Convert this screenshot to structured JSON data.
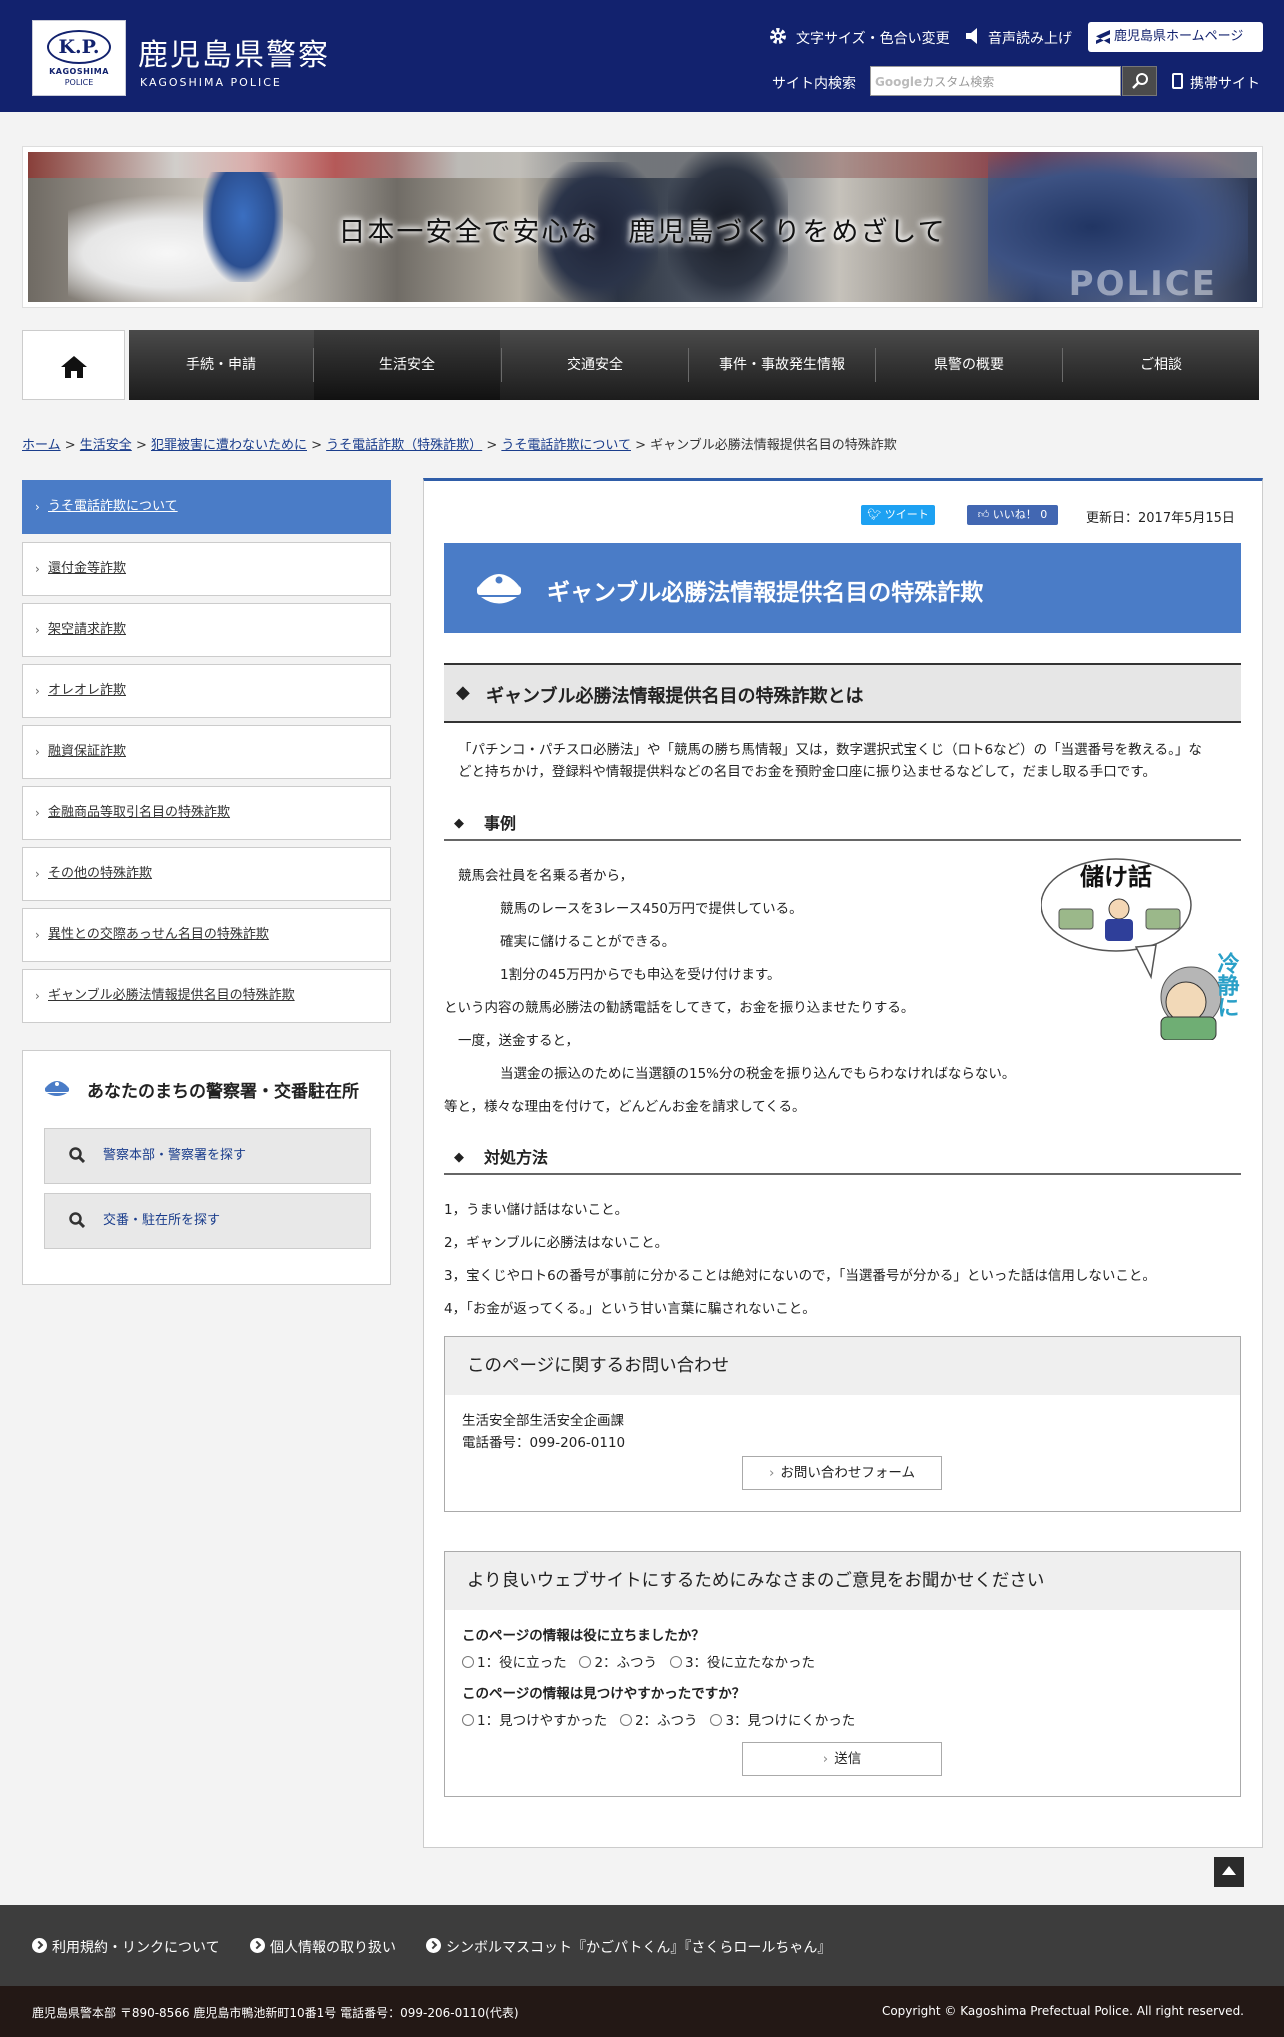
{
  "header": {
    "logo_mark": "K.P.",
    "logo_sub1": "KAGOSHIMA",
    "logo_sub2": "POLICE",
    "site_title": "鹿児島県警察",
    "site_subtitle": "KAGOSHIMA POLICE",
    "font_color_link": "文字サイズ・色合い変更",
    "voice_link": "音声読み上げ",
    "pref_link": "鹿児島県ホームページ",
    "search_label": "サイト内検索",
    "search_placeholder": "カスタム検索",
    "search_google": "Google",
    "mobile_link": "携帯サイト"
  },
  "banner": {
    "slogan": "日本一安全で安心な　鹿児島づくりをめざして",
    "police_text": "POLICE"
  },
  "nav": {
    "items": [
      {
        "label": "手続・申請"
      },
      {
        "label": "生活安全"
      },
      {
        "label": "交通安全"
      },
      {
        "label": "事件・事故発生情報"
      },
      {
        "label": "県警の概要"
      },
      {
        "label": "ご相談"
      }
    ]
  },
  "breadcrumb": {
    "items": [
      "ホーム",
      "生活安全",
      "犯罪被害に遭わないために",
      "うそ電話詐欺（特殊詐欺）",
      "うそ電話詐欺について"
    ],
    "sep": " > ",
    "current": "ギャンブル必勝法情報提供名目の特殊詐欺"
  },
  "sidebar": {
    "items": [
      {
        "label": "うそ電話詐欺について"
      },
      {
        "label": "還付金等詐欺"
      },
      {
        "label": "架空請求詐欺"
      },
      {
        "label": "オレオレ詐欺"
      },
      {
        "label": "融資保証詐欺"
      },
      {
        "label": "金融商品等取引名目の特殊詐欺"
      },
      {
        "label": "その他の特殊詐欺"
      },
      {
        "label": "異性との交際あっせん名目の特殊詐欺"
      },
      {
        "label": "ギャンブル必勝法情報提供名目の特殊詐欺"
      }
    ],
    "station_title": "あなたのまちの警察署・交番駐在所",
    "station_btn1": "警察本部・警察署を探す",
    "station_btn2": "交番・駐在所を探す"
  },
  "main": {
    "tweet": "ツイート",
    "like": "いいね！ 0",
    "updated": "更新日：2017年5月15日",
    "title": "ギャンブル必勝法情報提供名目の特殊詐欺",
    "h2": "ギャンブル必勝法情報提供名目の特殊詐欺とは",
    "intro_line1": "「パチンコ・パチスロ必勝法」や「競馬の勝ち馬情報」又は，数字選択式宝くじ（ロト6など）の「当選番号を教える。」な",
    "intro_line2": "どと持ちかけ，登録料や情報提供料などの名目でお金を預貯金口座に振り込ませるなどして，だまし取る手口です。",
    "h3_case": "事例",
    "case_lines": [
      "競馬会社員を名乗る者から，",
      "競馬のレースを3レース450万円で提供している。",
      "確実に儲けることができる。",
      "1割分の45万円からでも申込を受け付けます。",
      "という内容の競馬必勝法の勧誘電話をしてきて，お金を振り込ませたりする。",
      "一度，送金すると，",
      "当選金の振込のために当選額の15%分の税金を振り込んでもらわなければならない。",
      "等と，様々な理由を付けて，どんどんお金を請求してくる。"
    ],
    "illust_text1": "儲け話",
    "illust_text2": "冷静に",
    "h3_measure": "対処方法",
    "measure_lines": [
      "1，うまい儲け話はないこと。",
      "2，ギャンブルに必勝法はないこと。",
      "3，宝くじやロト6の番号が事前に分かることは絶対にないので，「当選番号が分かる」といった話は信用しないこと。",
      "4，「お金が返ってくる。」という甘い言葉に騙されないこと。"
    ]
  },
  "contact": {
    "heading": "このページに関するお問い合わせ",
    "dept": "生活安全部生活安全企画課",
    "phone": "電話番号：099-206-0110",
    "form_btn": "お問い合わせフォーム"
  },
  "survey": {
    "heading": "より良いウェブサイトにするためにみなさまのご意見をお聞かせください",
    "q1": "このページの情報は役に立ちましたか？",
    "q1_opts": [
      "1：役に立った",
      "2：ふつう",
      "3：役に立たなかった"
    ],
    "q2": "このページの情報は見つけやすかったですか？",
    "q2_opts": [
      "1：見つけやすかった",
      "2：ふつう",
      "3：見つけにくかった"
    ],
    "submit": "送信"
  },
  "footer": {
    "links": [
      "利用規約・リンクについて",
      "個人情報の取り扱い",
      "シンボルマスコット『かごパトくん』『さくらロールちゃん』"
    ],
    "address": "鹿児島県警本部 〒890-8566 鹿児島市鴨池新町10番1号 電話番号：099-206-0110(代表)",
    "copyright": "Copyright © Kagoshima Prefectual Police. All right reserved."
  },
  "colors": {
    "header_bg": "#12226e",
    "accent_blue": "#4a7cc7",
    "nav_bg": "#2a2a2a",
    "footer_bg": "#3d3d3d"
  }
}
